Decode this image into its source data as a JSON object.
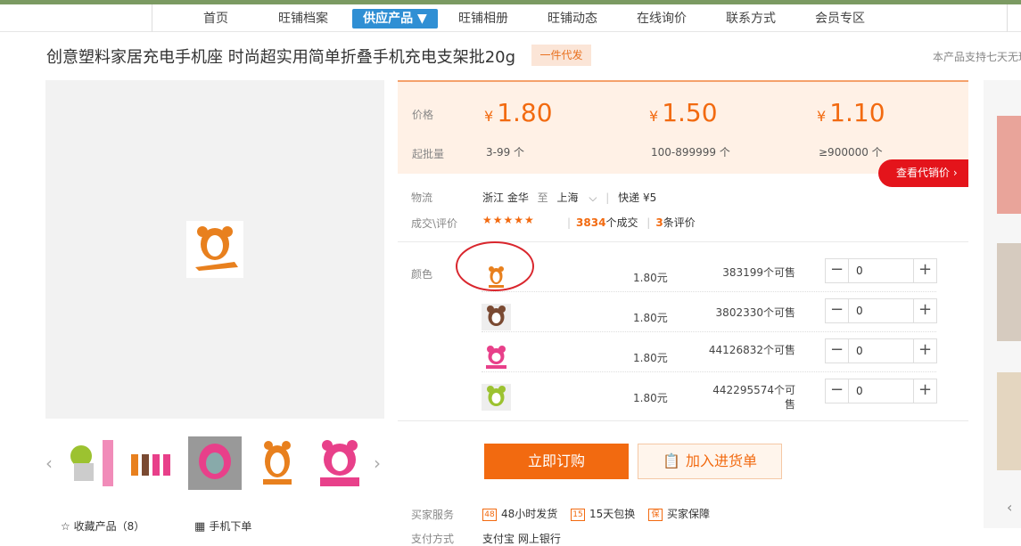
{
  "nav": {
    "items": [
      "首页",
      "旺铺档案",
      "供应产品 ▼",
      "旺铺相册",
      "旺铺动态",
      "在线询价",
      "联系方式",
      "会员专区"
    ]
  },
  "product": {
    "title": "创意塑料家居充电手机座 时尚超实用简单折叠手机充电支架批20g",
    "badge": "一件代发",
    "note": "本产品支持七天无理"
  },
  "price": {
    "label_price": "价格",
    "label_qty": "起批量",
    "yen": "¥",
    "tiers": [
      {
        "price": "1.80",
        "qty": "3-99 个"
      },
      {
        "price": "1.50",
        "qty": "100-899999 个"
      },
      {
        "price": "1.10",
        "qty": "≥900000 个"
      }
    ],
    "agent_button": "查看代销价 ›"
  },
  "logistics": {
    "label": "物流",
    "from": "浙江 金华",
    "to_word": "至",
    "to": "上海",
    "express": "快递 ¥5"
  },
  "deals": {
    "label": "成交\\评价",
    "stars": "★★★★★",
    "count": "3834",
    "count_suffix": "个成交",
    "reviews": "3",
    "reviews_suffix": "条评价"
  },
  "sku": {
    "label": "颜色",
    "rows": [
      {
        "price": "1.80元",
        "stock": "383199个可售",
        "qty": "0",
        "color": "#e8801e"
      },
      {
        "price": "1.80元",
        "stock": "3802330个可售",
        "qty": "0",
        "color": "#7a4a32"
      },
      {
        "price": "1.80元",
        "stock": "44126832个可售",
        "qty": "0",
        "color": "#e8408a"
      },
      {
        "price": "1.80元",
        "stock": "442295574个可售",
        "qty": "0",
        "color": "#9cc230"
      }
    ]
  },
  "actions": {
    "buy": "立即订购",
    "cart": "加入进货单"
  },
  "services": {
    "label": "买家服务",
    "items": [
      {
        "icon": "48",
        "text": "48小时发货"
      },
      {
        "icon": "15",
        "text": "15天包换"
      },
      {
        "icon": "保",
        "text": "买家保障"
      }
    ],
    "pay_label": "支付方式",
    "pay_text": "支付宝  网上银行"
  },
  "gallery": {
    "favorite": "收藏产品（8）",
    "mobile_order": "手机下单"
  },
  "colors": {
    "accent": "#f26a10",
    "nav_active": "#2f8fd4",
    "agent_red": "#e4141b"
  }
}
